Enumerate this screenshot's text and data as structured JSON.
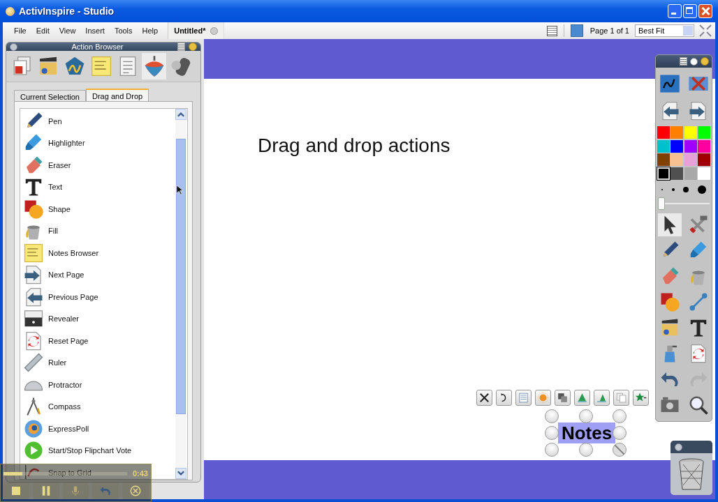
{
  "window": {
    "title": "ActivInspire - Studio"
  },
  "menu": [
    "File",
    "Edit",
    "View",
    "Insert",
    "Tools",
    "Help"
  ],
  "document_tab": {
    "label": "Untitled*"
  },
  "page_indicator": "Page 1 of 1",
  "zoom": {
    "value": "Best Fit"
  },
  "action_browser": {
    "title": "Action Browser",
    "categories": [
      {
        "kind": "pages",
        "selected": false
      },
      {
        "kind": "media",
        "selected": false
      },
      {
        "kind": "shape",
        "selected": false
      },
      {
        "kind": "note",
        "selected": false
      },
      {
        "kind": "form",
        "selected": false
      },
      {
        "kind": "top",
        "selected": true
      },
      {
        "kind": "device",
        "selected": false
      }
    ],
    "tabs": [
      {
        "label": "Current Selection",
        "selected": false
      },
      {
        "label": "Drag and Drop",
        "selected": true
      }
    ],
    "actions": [
      {
        "label": "Pen",
        "kind": "pen"
      },
      {
        "label": "Highlighter",
        "kind": "highlighter"
      },
      {
        "label": "Eraser",
        "kind": "eraser"
      },
      {
        "label": "Text",
        "kind": "text"
      },
      {
        "label": "Shape",
        "kind": "shape"
      },
      {
        "label": "Fill",
        "kind": "fill"
      },
      {
        "label": "Notes Browser",
        "kind": "note"
      },
      {
        "label": "Next Page",
        "kind": "next"
      },
      {
        "label": "Previous Page",
        "kind": "prev"
      },
      {
        "label": "Revealer",
        "kind": "revealer"
      },
      {
        "label": "Reset Page",
        "kind": "reset"
      },
      {
        "label": "Ruler",
        "kind": "ruler"
      },
      {
        "label": "Protractor",
        "kind": "protractor"
      },
      {
        "label": "Compass",
        "kind": "compass"
      },
      {
        "label": "ExpressPoll",
        "kind": "orb"
      },
      {
        "label": "Start/Stop Flipchart Vote",
        "kind": "play"
      },
      {
        "label": "Snap to Grid",
        "kind": "graph"
      }
    ]
  },
  "canvas": {
    "heading": "Drag and drop actions",
    "note": {
      "text": "Notes"
    },
    "object_tools": [
      {
        "kind": "expand"
      },
      {
        "kind": "rotate"
      },
      {
        "kind": "menu"
      },
      {
        "kind": "sun"
      },
      {
        "kind": "layers"
      },
      {
        "kind": "tree"
      },
      {
        "kind": "tree2"
      },
      {
        "kind": "duplicate"
      },
      {
        "kind": "star"
      }
    ]
  },
  "toolbox": {
    "tools_top": [
      {
        "kind": "screenpen"
      },
      {
        "kind": "tools"
      },
      {
        "kind": "prev"
      },
      {
        "kind": "next"
      }
    ],
    "colors": [
      {
        "color": "#ff0000",
        "selected": false
      },
      {
        "color": "#ff8000",
        "selected": false
      },
      {
        "color": "#ffff00",
        "selected": false
      },
      {
        "color": "#00ff00",
        "selected": false
      },
      {
        "color": "#00c0d0",
        "selected": false
      },
      {
        "color": "#0000ff",
        "selected": false
      },
      {
        "color": "#a000ff",
        "selected": false
      },
      {
        "color": "#ff00a0",
        "selected": false
      },
      {
        "color": "#804000",
        "selected": false
      },
      {
        "color": "#f8c090",
        "selected": false
      },
      {
        "color": "#e8a0d8",
        "selected": false
      },
      {
        "color": "#a00000",
        "selected": false
      },
      {
        "color": "#000000",
        "selected": true
      },
      {
        "color": "#505050",
        "selected": false
      },
      {
        "color": "#a8a8a8",
        "selected": false
      },
      {
        "color": "#ffffff",
        "selected": false
      }
    ],
    "width": {
      "level": 0.0
    },
    "tools": [
      {
        "kind": "select",
        "selected": true,
        "disabled": false
      },
      {
        "kind": "toolset",
        "selected": false,
        "disabled": false
      },
      {
        "kind": "pen",
        "selected": false,
        "disabled": false
      },
      {
        "kind": "highlighter",
        "selected": false,
        "disabled": false
      },
      {
        "kind": "eraser",
        "selected": false,
        "disabled": false
      },
      {
        "kind": "fill",
        "selected": false,
        "disabled": false
      },
      {
        "kind": "shape",
        "selected": false,
        "disabled": false
      },
      {
        "kind": "connector",
        "selected": false,
        "disabled": false
      },
      {
        "kind": "media",
        "selected": false,
        "disabled": false
      },
      {
        "kind": "text",
        "selected": false,
        "disabled": false
      },
      {
        "kind": "spray",
        "selected": false,
        "disabled": false
      },
      {
        "kind": "reset",
        "selected": false,
        "disabled": false
      },
      {
        "kind": "undo",
        "selected": false,
        "disabled": false
      },
      {
        "kind": "redo",
        "selected": false,
        "disabled": true
      },
      {
        "kind": "camera",
        "selected": false,
        "disabled": false
      },
      {
        "kind": "zoom",
        "selected": false,
        "disabled": false
      }
    ]
  },
  "recorder": {
    "level": 0.15,
    "time": "0:43",
    "buttons": [
      {
        "kind": "stop"
      },
      {
        "kind": "pause"
      },
      {
        "kind": "mic"
      },
      {
        "kind": "undo"
      },
      {
        "kind": "close"
      }
    ]
  }
}
